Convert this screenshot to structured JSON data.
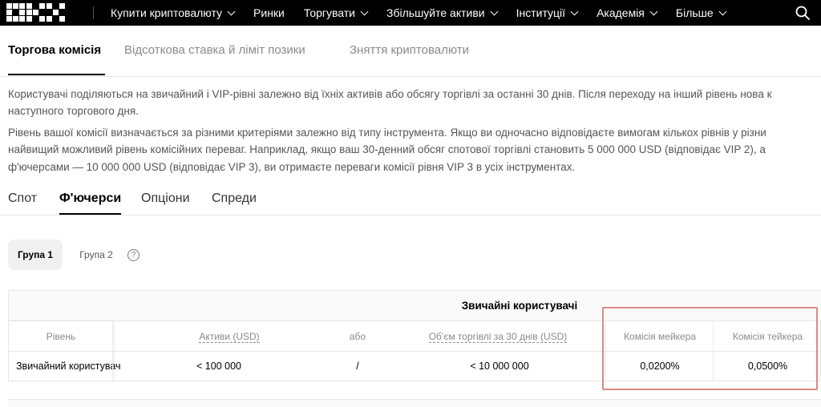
{
  "nav": {
    "items": [
      {
        "label": "Купити криптовалюту",
        "chevron": true
      },
      {
        "label": "Ринки",
        "chevron": false
      },
      {
        "label": "Торгувати",
        "chevron": true
      },
      {
        "label": "Збільшуйте активи",
        "chevron": true
      },
      {
        "label": "Інституції",
        "chevron": true
      },
      {
        "label": "Академія",
        "chevron": true
      },
      {
        "label": "Більше",
        "chevron": true
      }
    ],
    "search_icon": "search-icon"
  },
  "page_tabs": {
    "fee": "Торгова комісія",
    "interest": "Відсоткова ставка й ліміт позики",
    "withdrawal": "Зняття криптовалюти"
  },
  "paragraphs": {
    "p1_line1": "Користувачі поділяються на звичайний і VIP-рівні залежно від їхніх активів або обсягу торгівлі за останні 30 днів. Після переходу на інший рівень нова к",
    "p1_line2": "наступного торгового дня.",
    "p2_line1": "Рівень вашої комісії визначається за різними критеріями залежно від типу інструмента. Якщо ви одночасно відповідаєте вимогам кількох рівнів у різни",
    "p2_line2": "найвищий можливий рівень комісійних переваг. Наприклад, якщо ваш 30-денний обсяг спотової торгівлі становить 5 000 000 USD (відповідає VIP 2), а",
    "p2_line3": "ф'ючерсами — 10 000 000 USD (відповідає VIP 3), ви отримаєте переваги комісії рівня VIP 3 в усіх інструментах."
  },
  "instrument_tabs": {
    "spot": "Спот",
    "futures": "Ф'ючерси",
    "options": "Опціони",
    "spreads": "Спреди"
  },
  "groups": {
    "group1": "Група 1",
    "group2": "Група 2",
    "help": "?"
  },
  "table": {
    "title": "Звичайні користувачі",
    "headers": {
      "level": "Рівень",
      "assets": "Активи (USD)",
      "or": "або",
      "volume": "Об'єм торгівлі за 30 днів (USD)",
      "maker": "Комісія мейкера",
      "taker": "Комісія тейкера"
    },
    "row": {
      "level": "Звичайний користувач",
      "assets": "< 100 000",
      "or": "/",
      "volume": "< 10 000 000",
      "maker": "0,0200%",
      "taker": "0,0500%"
    }
  },
  "colors": {
    "nav_bg": "#000000",
    "highlight_border": "#d98a86",
    "muted_text": "#8a8a8a"
  }
}
